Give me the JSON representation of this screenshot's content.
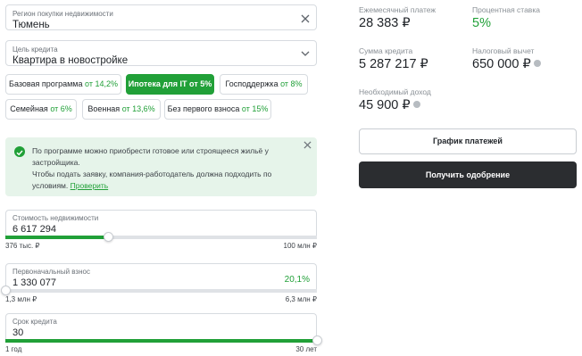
{
  "region": {
    "label": "Регион покупки недвижимости",
    "value": "Тюмень"
  },
  "purpose": {
    "label": "Цель кредита",
    "value": "Квартира в новостройке"
  },
  "programs": [
    {
      "name": "Базовая программа",
      "rate": "от 14,2%"
    },
    {
      "name": "Ипотека для IT",
      "rate": "от 5%"
    },
    {
      "name": "Господдержка",
      "rate": "от 8%"
    },
    {
      "name": "Семейная",
      "rate": "от 6%"
    },
    {
      "name": "Военная",
      "rate": "от 13,6%"
    },
    {
      "name": "Без первого взноса",
      "rate": "от 15%"
    }
  ],
  "notice": {
    "line1": "По программе можно приобрести готовое или строящееся жильё у застройщика.",
    "line2": "Чтобы подать заявку, компания-работодатель должна подходить по условиям.",
    "link": "Проверить"
  },
  "property_cost": {
    "label": "Стоимость недвижимости",
    "value": "6 617 294",
    "min": "376 тыс. ₽",
    "max": "100 млн ₽",
    "fill_fraction": 0.33
  },
  "down_payment": {
    "label": "Первоначальный взнос",
    "value": "1 330 077",
    "percent": "20,1%",
    "min": "1,3 млн ₽",
    "max": "6,3 млн ₽",
    "fill_fraction": 0.0
  },
  "term": {
    "label": "Срок кредита",
    "value": "30",
    "min": "1 год",
    "max": "30 лет",
    "fill_fraction": 1.0
  },
  "summary": {
    "monthly_label": "Ежемесячный платеж",
    "monthly_value": "28 383 ₽",
    "rate_label": "Процентная ставка",
    "rate_value": "5%",
    "loan_label": "Сумма кредита",
    "loan_value": "5 287 217 ₽",
    "deduction_label": "Налоговый вычет",
    "deduction_value": "650 000 ₽",
    "income_label": "Необходимый доход",
    "income_value": "45 900 ₽"
  },
  "actions": {
    "schedule": "График платежей",
    "approval": "Получить одобрение"
  },
  "colors": {
    "accent": "#21a038",
    "notice_bg": "#e6f4ea",
    "dark_button": "#2b2d30"
  },
  "icons": {
    "clear": "close-icon",
    "dropdown": "chevron-down-icon",
    "check": "check-circle-icon",
    "info": "info-icon"
  }
}
